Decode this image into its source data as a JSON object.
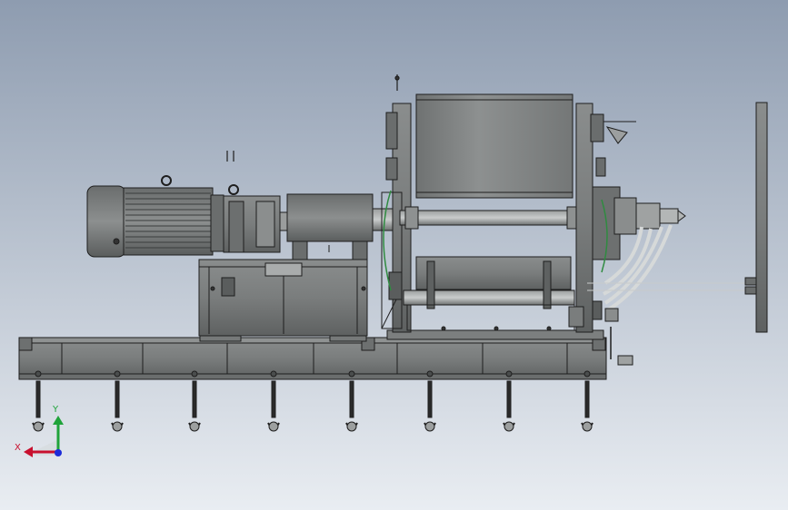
{
  "viewport": {
    "background_top": "#8e9cb0",
    "background_bottom": "#e9edf2",
    "part_color": "#7f8282",
    "edge_color": "#1e1e1e"
  },
  "triad": {
    "x_label": "X",
    "y_label": "Y",
    "x_color": "#c8102e",
    "y_color": "#1fa33a",
    "z_color": "#1c2bd8"
  },
  "model": {
    "foot_count": 8
  }
}
